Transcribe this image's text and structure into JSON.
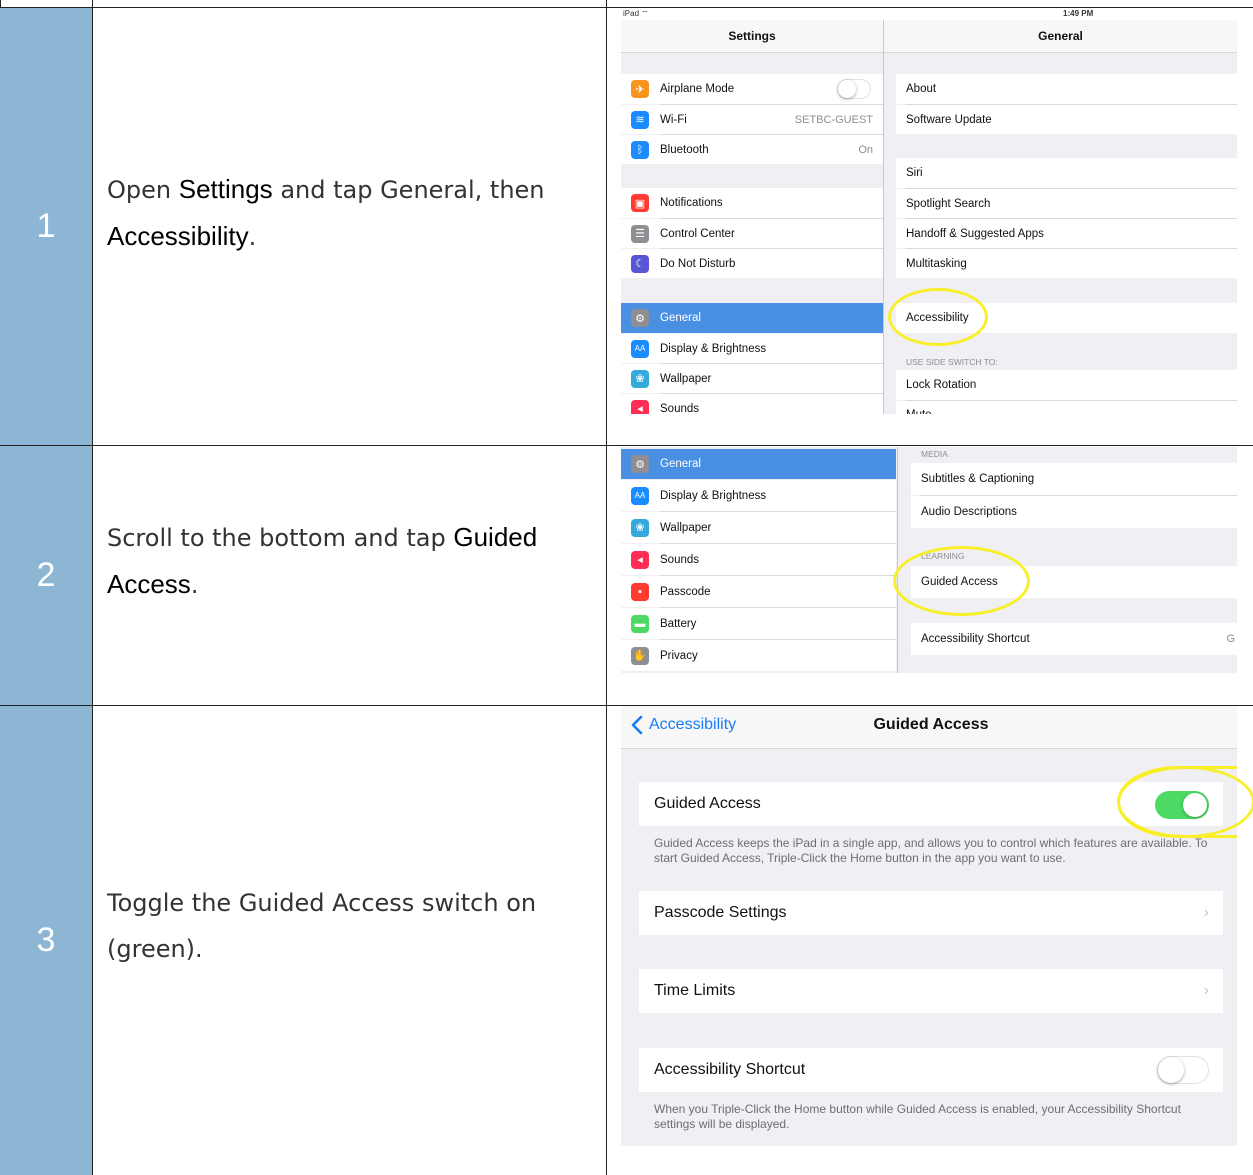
{
  "steps": [
    {
      "number": "1",
      "pre": "Open ",
      "b1": "Settings",
      "mid": " and tap General, then ",
      "b2": "Accessibility",
      "post": "."
    },
    {
      "number": "2",
      "pre": "Scroll to the bottom and tap ",
      "b1": "Guided Access",
      "post": "."
    },
    {
      "number": "3",
      "text": "Toggle the Guided Access switch on (green)."
    }
  ],
  "shot1": {
    "status_left": "iPad",
    "status_time": "1:49 PM",
    "left_title": "Settings",
    "right_title": "General",
    "left_items": [
      {
        "label": "Airplane Mode",
        "color": "#f7941d",
        "icon": "airplane-icon",
        "glyph": "✈"
      },
      {
        "label": "Wi-Fi",
        "color": "#1a8cff",
        "icon": "wifi-icon",
        "glyph": "≋",
        "detail": "SETBC-GUEST"
      },
      {
        "label": "Bluetooth",
        "color": "#1a8cff",
        "icon": "bluetooth-icon",
        "glyph": "ᛒ",
        "detail": "On"
      },
      {
        "label": "Notifications",
        "color": "#ff3b30",
        "icon": "notifications-icon",
        "glyph": "▣"
      },
      {
        "label": "Control Center",
        "color": "#8e8e93",
        "icon": "control-center-icon",
        "glyph": "☰"
      },
      {
        "label": "Do Not Disturb",
        "color": "#5856d6",
        "icon": "moon-icon",
        "glyph": "☾"
      },
      {
        "label": "General",
        "color": "#8e8e93",
        "icon": "gear-icon",
        "glyph": "⚙"
      },
      {
        "label": "Display & Brightness",
        "color": "#1a8cff",
        "icon": "display-icon",
        "glyph": "AA"
      },
      {
        "label": "Wallpaper",
        "color": "#34aadc",
        "icon": "wallpaper-icon",
        "glyph": "❀"
      },
      {
        "label": "Sounds",
        "color": "#ff2d55",
        "icon": "sounds-icon",
        "glyph": "◂"
      }
    ],
    "right_items": [
      "About",
      "Software Update",
      "Siri",
      "Spotlight Search",
      "Handoff & Suggested Apps",
      "Multitasking",
      "Accessibility",
      "Lock Rotation",
      "Mute"
    ],
    "side_switch_header": "USE SIDE SWITCH TO:"
  },
  "shot2": {
    "left_items": [
      {
        "label": "General",
        "color": "#8e8e93",
        "icon": "gear-icon",
        "glyph": "⚙"
      },
      {
        "label": "Display & Brightness",
        "color": "#1a8cff",
        "icon": "display-icon",
        "glyph": "AA"
      },
      {
        "label": "Wallpaper",
        "color": "#34aadc",
        "icon": "wallpaper-icon",
        "glyph": "❀"
      },
      {
        "label": "Sounds",
        "color": "#ff2d55",
        "icon": "sounds-icon",
        "glyph": "◂"
      },
      {
        "label": "Passcode",
        "color": "#ff3b30",
        "icon": "lock-icon",
        "glyph": "▪"
      },
      {
        "label": "Battery",
        "color": "#4cd964",
        "icon": "battery-icon",
        "glyph": "▬"
      },
      {
        "label": "Privacy",
        "color": "#8e8e93",
        "icon": "hand-icon",
        "glyph": "✋"
      }
    ],
    "media_header": "MEDIA",
    "media_items": [
      "Subtitles & Captioning",
      "Audio Descriptions"
    ],
    "learning_header": "LEARNING",
    "learning_items": [
      "Guided Access"
    ],
    "shortcut_item": "Accessibility Shortcut",
    "shortcut_detail": "G"
  },
  "shot3": {
    "back_label": "Accessibility",
    "title": "Guided Access",
    "guided_access_label": "Guided Access",
    "guided_access_footer": "Guided Access keeps the iPad in a single app, and allows you to control which features are available. To start Guided Access, Triple-Click the Home button in the app you want to use.",
    "passcode_settings": "Passcode Settings",
    "time_limits": "Time Limits",
    "accessibility_shortcut": "Accessibility Shortcut",
    "shortcut_footer": "When you Triple-Click the Home button while Guided Access is enabled, your Accessibility Shortcut settings will be displayed.",
    "toggle_color": "#4cd964"
  }
}
